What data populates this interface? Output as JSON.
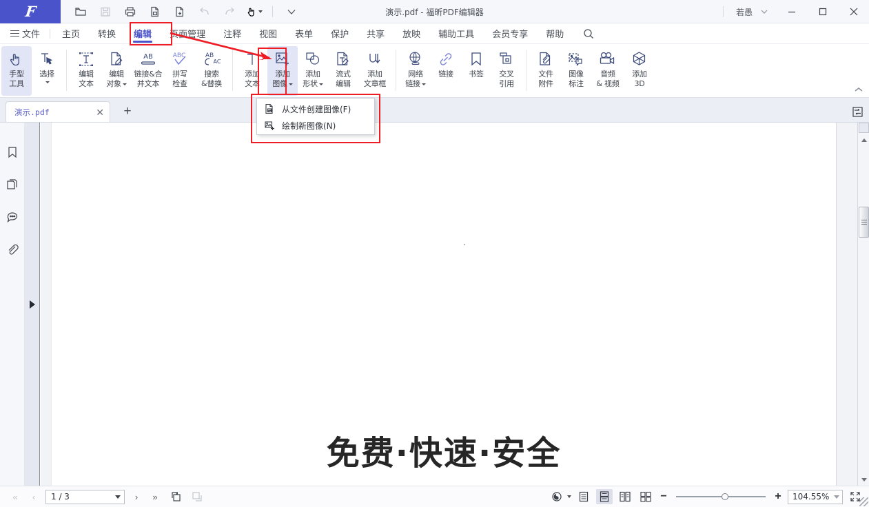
{
  "window": {
    "title": "演示.pdf - 福昕PDF编辑器",
    "user": "若愚",
    "logo": "F",
    "minimize_label": "—",
    "maximize_label": "□",
    "close_label": "✕"
  },
  "quick_access": [
    {
      "name": "open-icon",
      "label": "打开",
      "disabled": false
    },
    {
      "name": "save-icon",
      "label": "保存",
      "disabled": true
    },
    {
      "name": "print-icon",
      "label": "打印",
      "disabled": false
    },
    {
      "name": "save-as-icon",
      "label": "另存为",
      "disabled": false
    },
    {
      "name": "new-file-icon",
      "label": "新建",
      "disabled": false
    },
    {
      "name": "undo-icon",
      "label": "撤销",
      "disabled": true
    },
    {
      "name": "redo-icon",
      "label": "重做",
      "disabled": true
    },
    {
      "name": "hand-tool-icon",
      "label": "手型工具",
      "disabled": false
    },
    {
      "name": "customize-icon",
      "label": "自定义",
      "disabled": false
    }
  ],
  "menubar": {
    "file_label": "文件",
    "items": [
      {
        "label": "主页",
        "active": false
      },
      {
        "label": "转换",
        "active": false
      },
      {
        "label": "编辑",
        "active": true
      },
      {
        "label": "页面管理",
        "active": false
      },
      {
        "label": "注释",
        "active": false
      },
      {
        "label": "视图",
        "active": false
      },
      {
        "label": "表单",
        "active": false
      },
      {
        "label": "保护",
        "active": false
      },
      {
        "label": "共享",
        "active": false
      },
      {
        "label": "放映",
        "active": false
      },
      {
        "label": "辅助工具",
        "active": false
      },
      {
        "label": "会员专享",
        "active": false
      },
      {
        "label": "帮助",
        "active": false
      }
    ],
    "search_icon": "search-icon",
    "active_color": "#4a53c9"
  },
  "ribbon": {
    "groups": [
      {
        "items": [
          {
            "id": "hand-tool",
            "line1": "手型",
            "line2": "工具",
            "icon": "hand-icon",
            "selected": true,
            "caret": false
          },
          {
            "id": "select",
            "line1": "选择",
            "line2": "",
            "icon": "select-arrow-icon",
            "selected": false,
            "caret": true
          }
        ]
      },
      {
        "items": [
          {
            "id": "edit-text",
            "line1": "编辑",
            "line2": "文本",
            "icon": "edit-text-icon",
            "selected": false,
            "caret": false
          },
          {
            "id": "edit-object",
            "line1": "编辑",
            "line2": "对象",
            "icon": "edit-object-icon",
            "selected": false,
            "caret": true
          },
          {
            "id": "link-merge-text",
            "line1": "链接&合",
            "line2": "并文本",
            "icon": "link-merge-icon",
            "selected": false,
            "caret": false
          },
          {
            "id": "spell-check",
            "line1": "拼写",
            "line2": "检查",
            "icon": "spellcheck-icon",
            "selected": false,
            "caret": false
          },
          {
            "id": "search-replace",
            "line1": "搜索",
            "line2": "&替换",
            "icon": "search-replace-icon",
            "selected": false,
            "caret": false
          }
        ]
      },
      {
        "items": [
          {
            "id": "add-text",
            "line1": "添加",
            "line2": "文本",
            "icon": "add-text-icon",
            "selected": false,
            "caret": false
          },
          {
            "id": "add-image",
            "line1": "添加",
            "line2": "图像",
            "icon": "add-image-icon",
            "selected": true,
            "caret": true
          },
          {
            "id": "add-shape",
            "line1": "添加",
            "line2": "形状",
            "icon": "add-shape-icon",
            "selected": false,
            "caret": true
          },
          {
            "id": "flow-edit",
            "line1": "流式",
            "line2": "编辑",
            "icon": "flow-edit-icon",
            "selected": false,
            "caret": false
          },
          {
            "id": "add-article-box",
            "line1": "添加",
            "line2": "文章框",
            "icon": "article-box-icon",
            "selected": false,
            "caret": false
          }
        ]
      },
      {
        "items": [
          {
            "id": "web-link",
            "line1": "网络",
            "line2": "链接",
            "icon": "globe-link-icon",
            "selected": false,
            "caret": true
          },
          {
            "id": "link",
            "line1": "链接",
            "line2": "",
            "icon": "chain-link-icon",
            "selected": false,
            "caret": false
          },
          {
            "id": "bookmark",
            "line1": "书签",
            "line2": "",
            "icon": "bookmark-icon",
            "selected": false,
            "caret": false
          },
          {
            "id": "cross-reference",
            "line1": "交叉",
            "line2": "引用",
            "icon": "cross-ref-icon",
            "selected": false,
            "caret": false
          }
        ]
      },
      {
        "items": [
          {
            "id": "file-attachment",
            "line1": "文件",
            "line2": "附件",
            "icon": "attachment-file-icon",
            "selected": false,
            "caret": false
          },
          {
            "id": "image-annotation",
            "line1": "图像",
            "line2": "标注",
            "icon": "image-annotation-icon",
            "selected": false,
            "caret": false
          },
          {
            "id": "audio-video",
            "line1": "音频",
            "line2": "& 视频",
            "icon": "video-camera-icon",
            "selected": false,
            "caret": false
          },
          {
            "id": "add-3d",
            "line1": "添加",
            "line2": "3D",
            "icon": "cube-3d-icon",
            "selected": false,
            "caret": false
          }
        ]
      }
    ],
    "collapse_icon": "chevron-up-icon"
  },
  "dropdown": {
    "visible": true,
    "items": [
      {
        "label": "从文件创建图像(F)",
        "icon": "image-from-file-icon"
      },
      {
        "label": "绘制新图像(N)",
        "icon": "draw-new-image-icon"
      }
    ]
  },
  "tabstrip": {
    "tabs": [
      {
        "label": "演示.pdf",
        "active": true,
        "close_label": "✕"
      }
    ],
    "add_tab_label": "+",
    "right_panel_toggle_icon": "panel-toggle-icon"
  },
  "left_rail": {
    "items": [
      {
        "name": "bookmark-panel",
        "icon": "bookmark-icon"
      },
      {
        "name": "pages-panel",
        "icon": "pages-icon"
      },
      {
        "name": "comments-panel",
        "icon": "comment-icon"
      },
      {
        "name": "attachments-panel",
        "icon": "paperclip-icon"
      }
    ],
    "expander_icon": "triangle-right-icon"
  },
  "document": {
    "heading": "免费·快速·安全",
    "page_background": "#ffffff"
  },
  "statusbar": {
    "first_page_label": "«",
    "prev_page_label": "‹",
    "page_value": "1 / 3",
    "next_page_label": "›",
    "last_page_label": "»",
    "tool_icons": [
      {
        "name": "fit-page-icon",
        "disabled": false
      },
      {
        "name": "fit-width-icon",
        "disabled": true
      }
    ],
    "view_modes": [
      {
        "name": "rotate-view-icon",
        "active": false,
        "caret": true
      },
      {
        "name": "single-page-view-icon",
        "active": false,
        "caret": false
      },
      {
        "name": "continuous-view-icon",
        "active": true,
        "caret": false
      },
      {
        "name": "two-page-view-icon",
        "active": false,
        "caret": false
      },
      {
        "name": "two-page-continuous-view-icon",
        "active": false,
        "caret": false
      }
    ],
    "zoom_out_label": "−",
    "zoom_in_label": "+",
    "zoom_value": "104.55%",
    "fullscreen_icon": "fullscreen-icon"
  },
  "annotations": {
    "color": "#ee1c25",
    "boxes": [
      {
        "name": "edit-tab-highlight"
      },
      {
        "name": "add-image-button-highlight"
      },
      {
        "name": "dropdown-menu-highlight"
      }
    ],
    "arrow": {
      "name": "pointer-arrow",
      "from": "edit-tab",
      "to": "add-image-button"
    }
  }
}
